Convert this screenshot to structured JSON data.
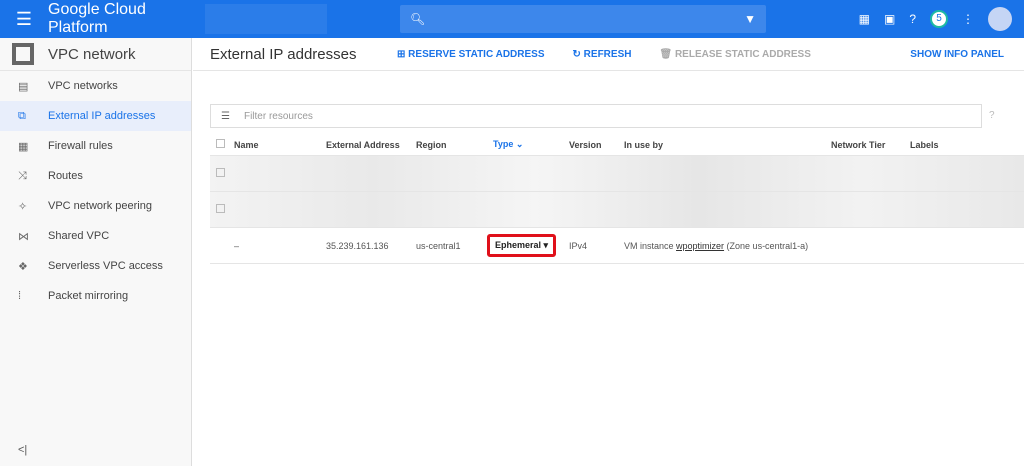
{
  "header": {
    "brand": "Google Cloud Platform",
    "notifications": "5"
  },
  "sidebar": {
    "title": "VPC network",
    "items": [
      {
        "label": "VPC networks",
        "icon": "▤"
      },
      {
        "label": "External IP addresses",
        "icon": "⧉",
        "active": true
      },
      {
        "label": "Firewall rules",
        "icon": "▦"
      },
      {
        "label": "Routes",
        "icon": "⤨"
      },
      {
        "label": "VPC network peering",
        "icon": "✧"
      },
      {
        "label": "Shared VPC",
        "icon": "⋈"
      },
      {
        "label": "Serverless VPC access",
        "icon": "❖"
      },
      {
        "label": "Packet mirroring",
        "icon": "⁞"
      }
    ],
    "collapse": "<|"
  },
  "toolbar": {
    "title": "External IP addresses",
    "reserve": "RESERVE STATIC ADDRESS",
    "refresh": "REFRESH",
    "release": "RELEASE STATIC ADDRESS",
    "info": "SHOW INFO PANEL"
  },
  "filter": {
    "placeholder": "Filter resources"
  },
  "table": {
    "headers": [
      "Name",
      "External Address",
      "Region",
      "Type ⌄",
      "Version",
      "In use by",
      "Network Tier",
      "Labels"
    ],
    "row": {
      "name": "–",
      "address": "35.239.161.136",
      "region": "us-central1",
      "type": "Ephemeral",
      "version": "IPv4",
      "inuse_prefix": "VM instance ",
      "inuse_link": "wpoptimizer",
      "inuse_suffix": " (Zone us-central1-a)"
    }
  },
  "colors": {
    "accent": "#1a73e8",
    "highlight": "#e0101a"
  }
}
